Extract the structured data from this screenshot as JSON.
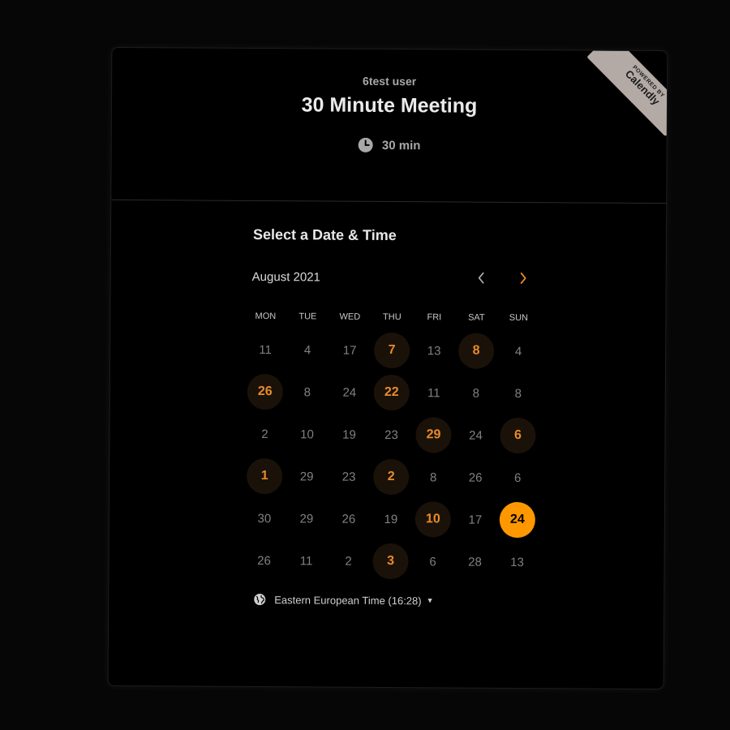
{
  "header": {
    "organizer": "6test user",
    "event_title": "30 Minute Meeting",
    "duration": "30 min",
    "clock_icon": "clock-icon"
  },
  "badge": {
    "small_text": "POWERED BY",
    "brand": "Calendly",
    "color": "#b3aaa6"
  },
  "calendar": {
    "section_title": "Select a Date & Time",
    "month": "August 2021",
    "prev_icon": "chevron-left-icon",
    "next_icon": "chevron-right-icon",
    "weekdays": [
      "MON",
      "TUE",
      "WED",
      "THU",
      "FRI",
      "SAT",
      "SUN"
    ],
    "weeks": [
      [
        {
          "label": "11",
          "state": "disabled"
        },
        {
          "label": "4",
          "state": "disabled"
        },
        {
          "label": "17",
          "state": "disabled"
        },
        {
          "label": "7",
          "state": "available"
        },
        {
          "label": "13",
          "state": "disabled"
        },
        {
          "label": "8",
          "state": "available"
        },
        {
          "label": "4",
          "state": "disabled"
        }
      ],
      [
        {
          "label": "26",
          "state": "available"
        },
        {
          "label": "8",
          "state": "disabled"
        },
        {
          "label": "24",
          "state": "disabled"
        },
        {
          "label": "22",
          "state": "available"
        },
        {
          "label": "11",
          "state": "disabled"
        },
        {
          "label": "8",
          "state": "disabled"
        },
        {
          "label": "8",
          "state": "disabled"
        }
      ],
      [
        {
          "label": "2",
          "state": "disabled"
        },
        {
          "label": "10",
          "state": "disabled"
        },
        {
          "label": "19",
          "state": "disabled"
        },
        {
          "label": "23",
          "state": "disabled"
        },
        {
          "label": "29",
          "state": "available"
        },
        {
          "label": "24",
          "state": "disabled"
        },
        {
          "label": "6",
          "state": "available"
        }
      ],
      [
        {
          "label": "1",
          "state": "available"
        },
        {
          "label": "29",
          "state": "disabled"
        },
        {
          "label": "23",
          "state": "disabled"
        },
        {
          "label": "2",
          "state": "available"
        },
        {
          "label": "8",
          "state": "disabled"
        },
        {
          "label": "26",
          "state": "disabled"
        },
        {
          "label": "6",
          "state": "disabled"
        }
      ],
      [
        {
          "label": "30",
          "state": "disabled"
        },
        {
          "label": "29",
          "state": "disabled"
        },
        {
          "label": "26",
          "state": "disabled"
        },
        {
          "label": "19",
          "state": "disabled"
        },
        {
          "label": "10",
          "state": "available"
        },
        {
          "label": "17",
          "state": "disabled"
        },
        {
          "label": "24",
          "state": "selected"
        }
      ],
      [
        {
          "label": "26",
          "state": "disabled"
        },
        {
          "label": "11",
          "state": "disabled"
        },
        {
          "label": "2",
          "state": "disabled"
        },
        {
          "label": "3",
          "state": "available"
        },
        {
          "label": "6",
          "state": "disabled"
        },
        {
          "label": "28",
          "state": "disabled"
        },
        {
          "label": "13",
          "state": "disabled"
        }
      ]
    ]
  },
  "timezone": {
    "label": "Eastern European Time (16:28)",
    "icon": "globe-icon"
  },
  "colors": {
    "accent": "#ff9800",
    "available_text": "#e88a2a",
    "background": "#000000"
  }
}
